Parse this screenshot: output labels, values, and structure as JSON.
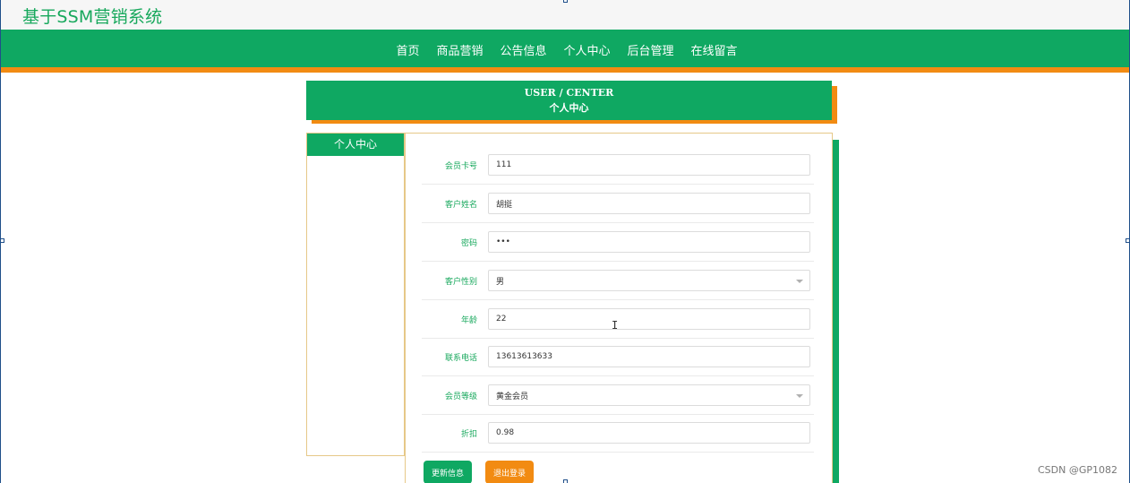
{
  "site": {
    "title": "基于SSM营销系统"
  },
  "nav": {
    "items": [
      "首页",
      "商品营销",
      "公告信息",
      "个人中心",
      "后台管理",
      "在线留言"
    ]
  },
  "user_center": {
    "title_en": "USER / CENTER",
    "title_cn": "个人中心"
  },
  "sidebar": {
    "title": "个人中心"
  },
  "form": {
    "card_no": {
      "label": "会员卡号",
      "value": "111"
    },
    "name": {
      "label": "客户姓名",
      "value": "胡挺"
    },
    "password": {
      "label": "密码",
      "value": "•••"
    },
    "gender": {
      "label": "客户性别",
      "value": "男"
    },
    "age": {
      "label": "年龄",
      "value": "22"
    },
    "phone": {
      "label": "联系电话",
      "value": "13613613633"
    },
    "level": {
      "label": "会员等级",
      "value": "黄金会员"
    },
    "discount": {
      "label": "折扣",
      "value": "0.98"
    }
  },
  "buttons": {
    "update": "更新信息",
    "logout": "退出登录"
  },
  "watermark": "CSDN @GP1082",
  "cursor_glyph": "I",
  "colors": {
    "primary_green": "#0fa862",
    "accent_orange": "#f28b12"
  }
}
